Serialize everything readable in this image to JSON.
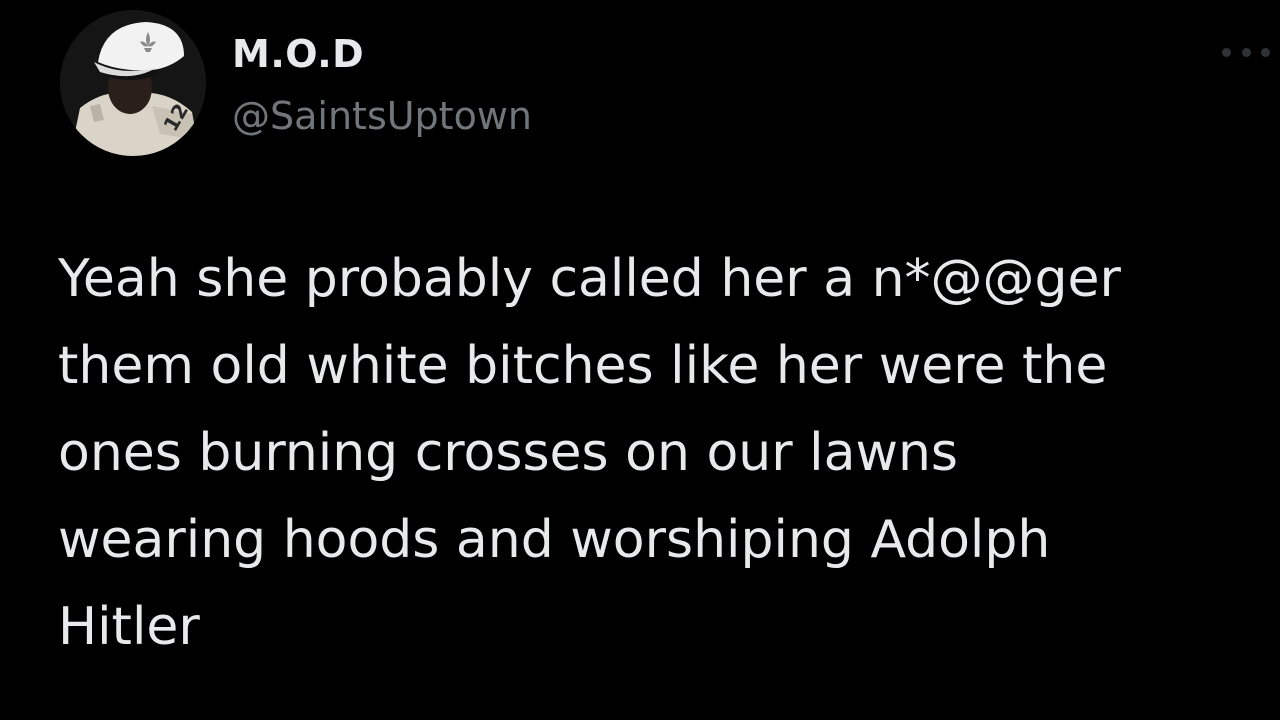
{
  "tweet": {
    "display_name": "M.O.D",
    "handle": "@SaintsUptown",
    "avatar_icon": "profile-photo",
    "more_icon": "more-options-icon",
    "text_lines": [
      "Yeah she probably called her a n*@@ger",
      "them old white bitches like her were the",
      "ones burning crosses on our lawns",
      "wearing hoods and worshiping Adolph",
      "Hitler"
    ]
  },
  "colors": {
    "background": "#000000",
    "primary_text": "#e7e9ea",
    "secondary_text": "#71767b",
    "more_icon": "#2f3336"
  }
}
